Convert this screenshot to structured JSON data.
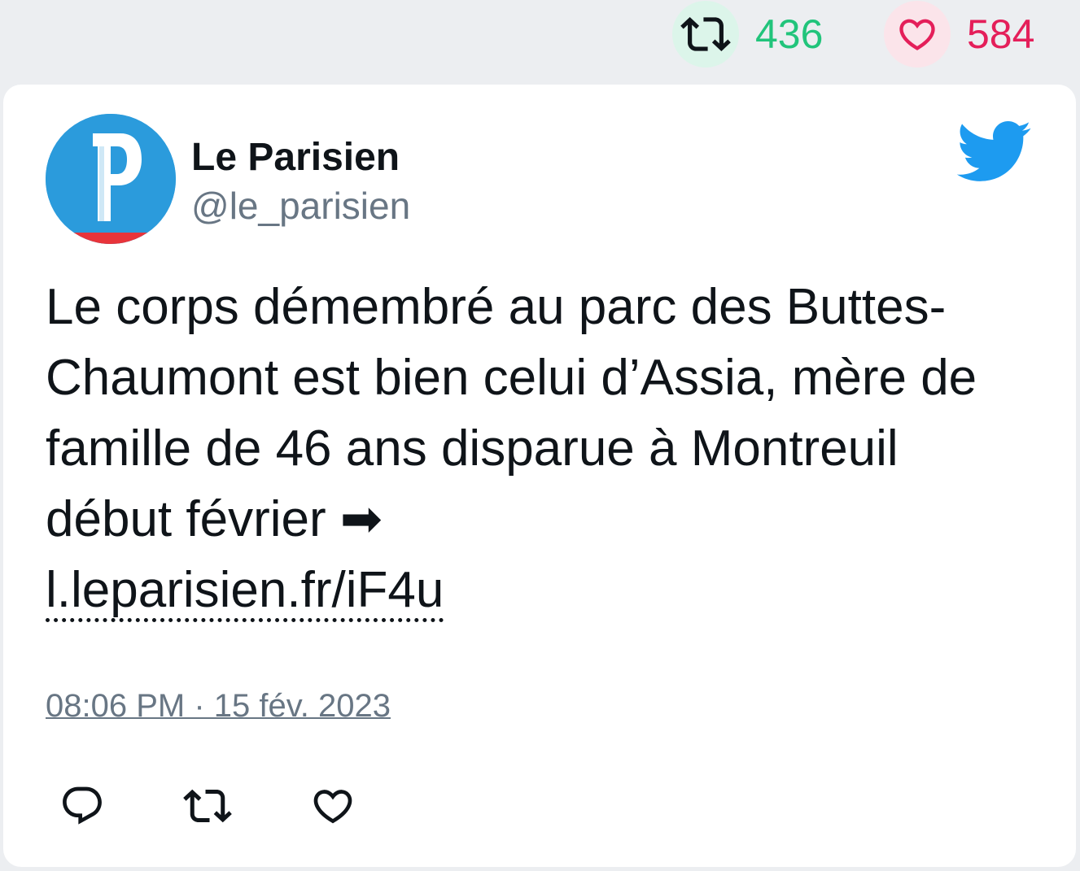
{
  "stats": {
    "retweets": "436",
    "likes": "584",
    "retweet_icon": "retweet-icon",
    "like_icon": "heart-icon",
    "retweet_color": "#21c47b",
    "like_color": "#e41f5a"
  },
  "tweet": {
    "author_name": "Le Parisien",
    "author_handle": "@le_parisien",
    "avatar_letter": "P",
    "text_body": "Le corps démembré au parc des Buttes-Chaumont est bien celui d’Assia, mère de famille de 46 ans disparue à Montreuil début février ➡",
    "link": "l.leparisien.fr/iF4u",
    "timestamp": "08:06 PM · 15 fév. 2023"
  },
  "colors": {
    "twitter_blue": "#1d9bf0",
    "avatar_bg": "#2b9bdc",
    "avatar_stripe": "#e8343a"
  },
  "actions": [
    "reply-icon",
    "retweet-icon",
    "heart-icon"
  ]
}
